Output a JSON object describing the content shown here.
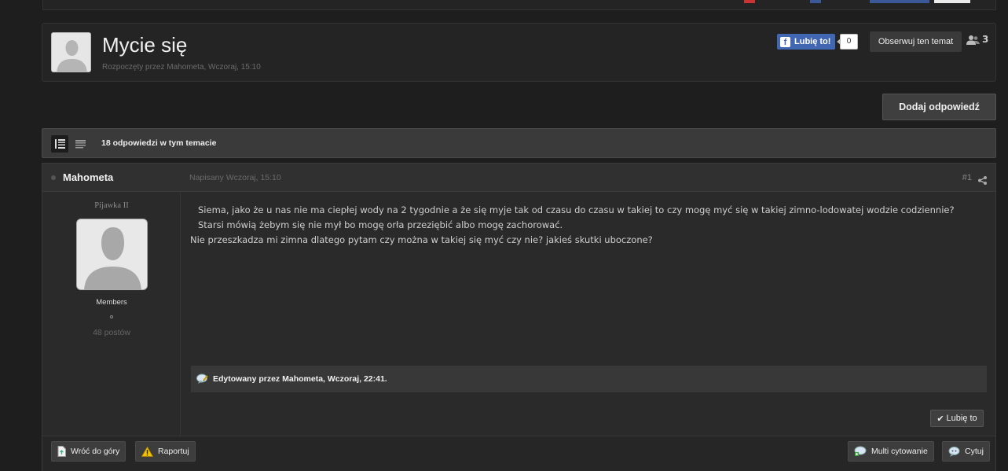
{
  "topic": {
    "title": "Mycie się",
    "started_by": "Rozpoczęty przez Mahometa, Wczoraj, 15:10"
  },
  "social": {
    "fb_like_label": "Lubię to!",
    "fb_like_count": "0",
    "follow_label": "Obserwuj ten temat",
    "followers_count": "3"
  },
  "actions": {
    "add_reply_label": "Dodaj odpowiedź"
  },
  "topic_bar": {
    "replies_text": "18 odpowiedzi w tym temacie"
  },
  "post": {
    "author": "Mahometa",
    "posted": "Napisany Wczoraj, 15:10",
    "number": "#1",
    "rank": "Pijawka II",
    "group": "Members",
    "post_count": "48 postów",
    "lines": [
      "Siema, jako że u nas nie ma ciepłej wody na 2 tygodnie a że się myje tak od czasu do czasu w takiej to czy mogę myć się w takiej zimno-lodowatej wodzie codziennie?",
      "Starsi mówią żebym się nie mył bo mogę orła przeziębić albo mogę zachorować.",
      "Nie przeszkadza mi zimna dlatego pytam czy można w takiej się myć czy nie? jakieś skutki uboczone?"
    ],
    "edited": "Edytowany przez Mahometa, Wczoraj, 22:41.",
    "like_label": "Lubię to"
  },
  "post_footer": {
    "back_to_top": "Wróć do góry",
    "report": "Raportuj",
    "multiquote": "Multi cytowanie",
    "quote": "Cytuj"
  },
  "colors": {
    "background": "#1e1e1e",
    "panel": "#242424",
    "facebook": "#4267b2"
  }
}
